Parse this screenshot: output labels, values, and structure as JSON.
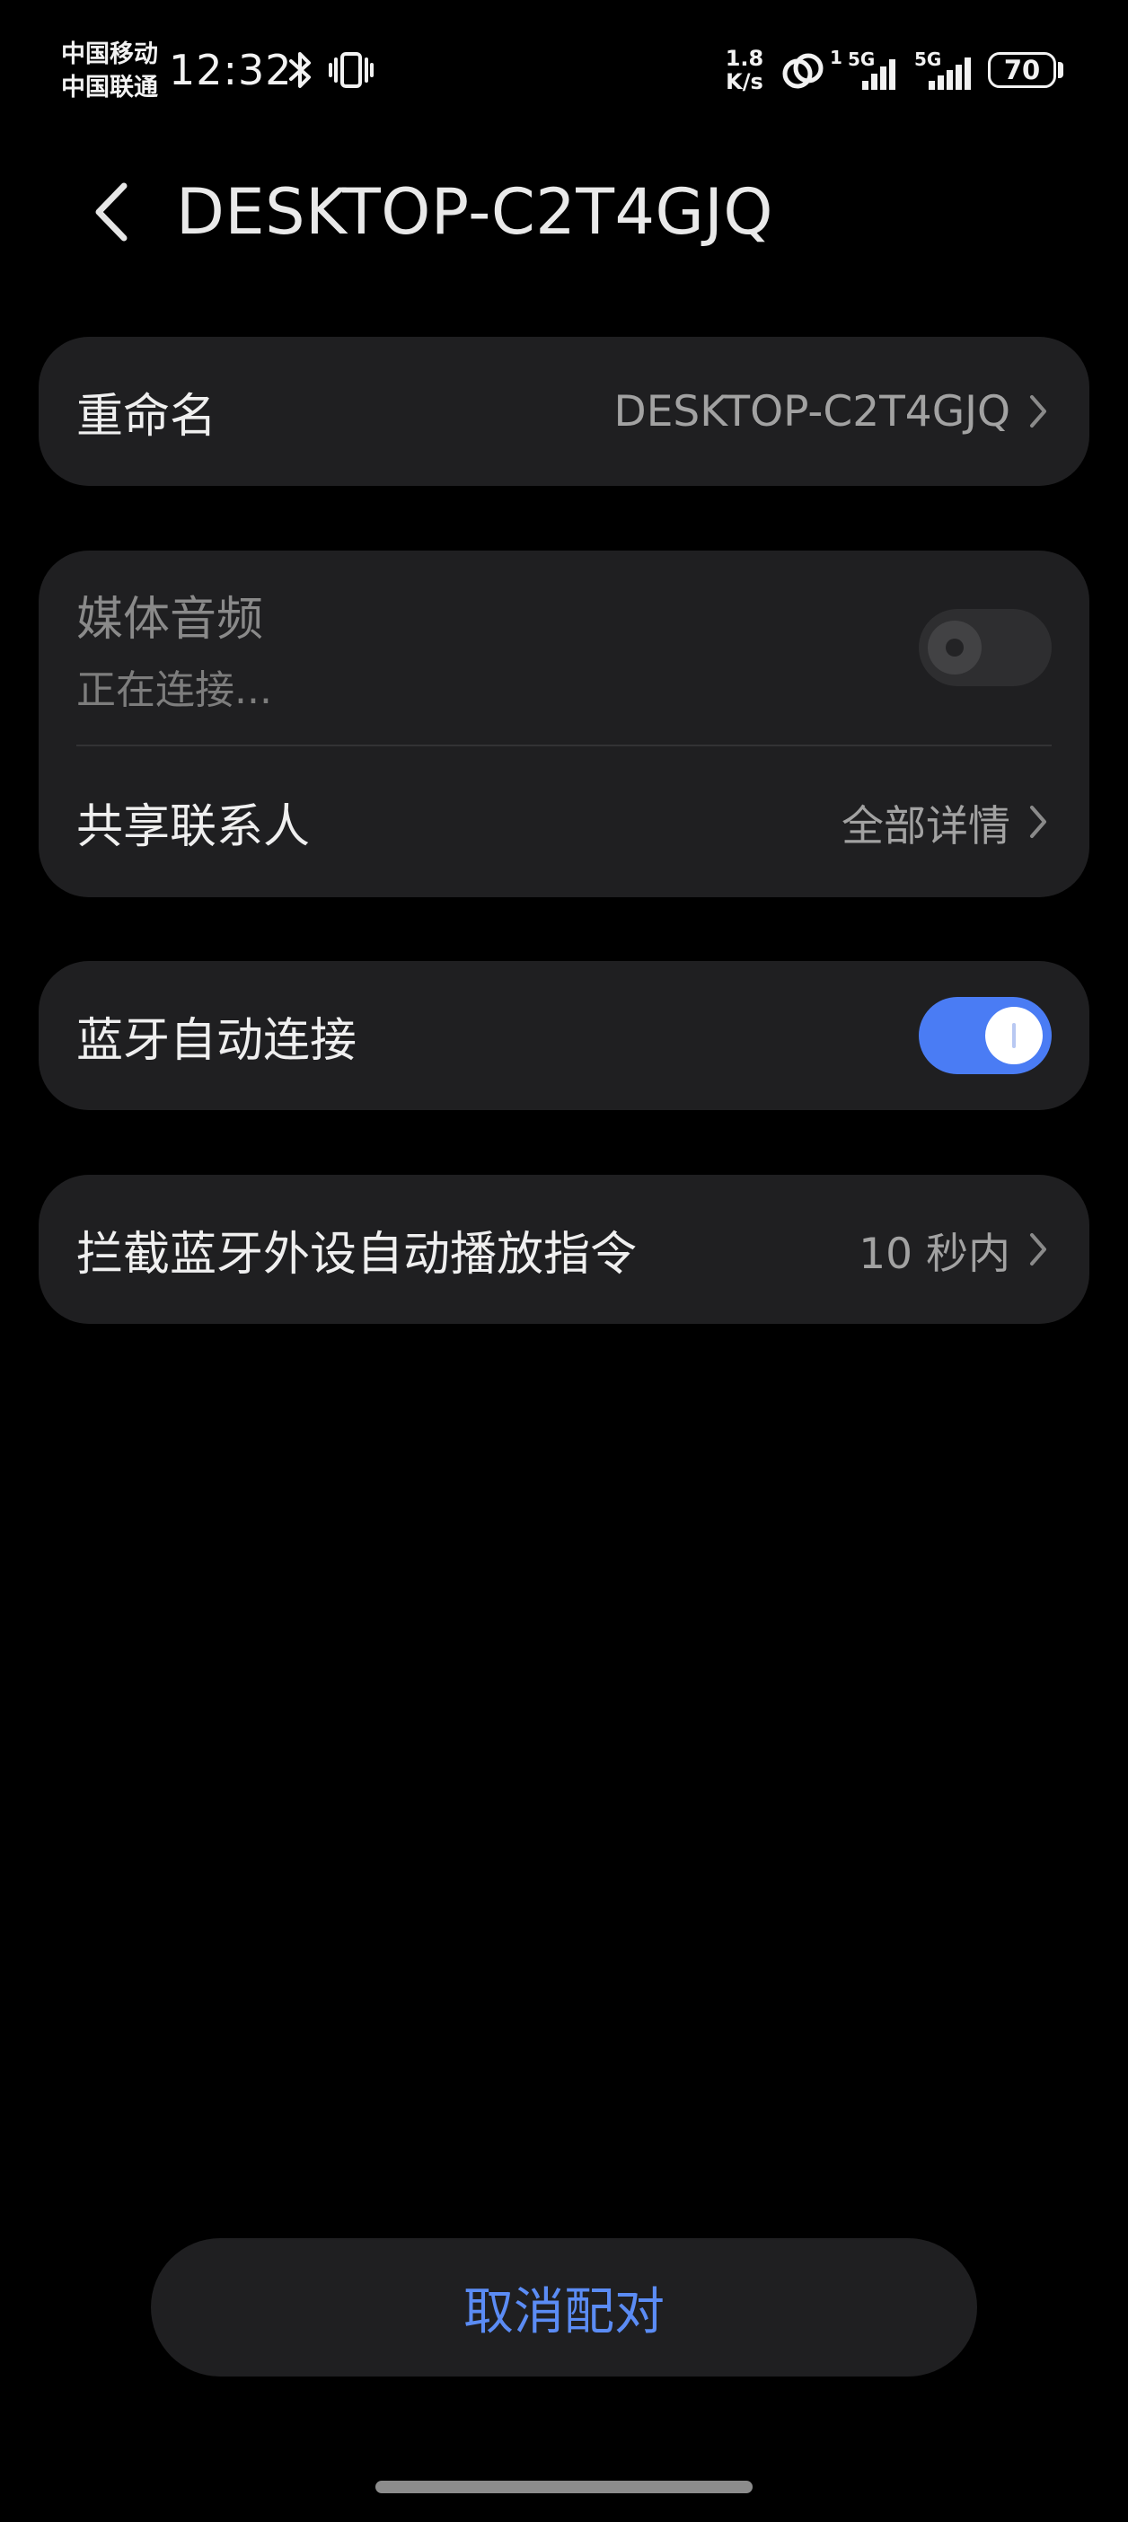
{
  "status_bar": {
    "carrier_1": "中国移动",
    "carrier_2": "中国联通",
    "time": "12:32",
    "net_speed_value": "1.8",
    "net_speed_unit": "K/s",
    "sim1_network": "5G",
    "sim2_network": "5G",
    "sim1_label": "1",
    "battery": "70",
    "icons": [
      "bluetooth-icon",
      "vibrate-icon",
      "hotspot-icon",
      "signal-icon",
      "battery-icon"
    ]
  },
  "header": {
    "title": "DESKTOP-C2T4GJQ"
  },
  "rename": {
    "label": "重命名",
    "value": "DESKTOP-C2T4GJQ"
  },
  "profiles": {
    "media_audio_label": "媒体音频",
    "media_audio_status": "正在连接...",
    "media_audio_enabled": false,
    "share_contacts_label": "共享联系人",
    "share_contacts_value": "全部详情"
  },
  "auto_connect": {
    "label": "蓝牙自动连接",
    "enabled": true
  },
  "intercept": {
    "label": "拦截蓝牙外设自动播放指令",
    "value": "10 秒内"
  },
  "actions": {
    "unpair_label": "取消配对"
  },
  "colors": {
    "background": "#000000",
    "card": "#1f1f21",
    "accent": "#4a7cf4",
    "accent_text": "#5b8cf5",
    "secondary_text": "#a2a2a2"
  }
}
